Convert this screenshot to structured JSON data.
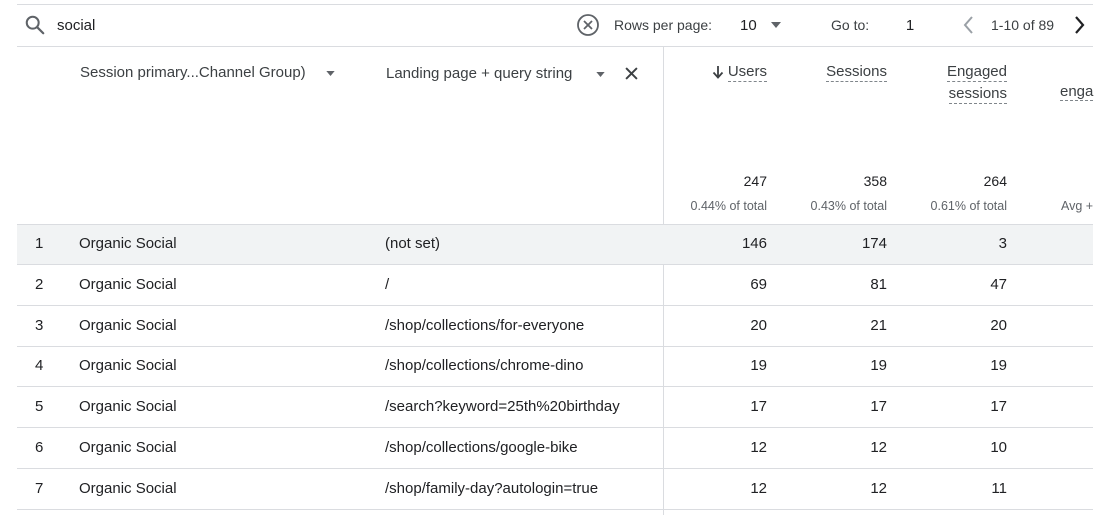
{
  "toolbar": {
    "search_value": "social",
    "rows_per_page_label": "Rows per page:",
    "rows_per_page_value": "10",
    "goto_label": "Go to:",
    "goto_value": "1",
    "range_text": "1-10 of 89"
  },
  "columns": {
    "dimension1": "Session primary...Channel Group)",
    "dimension2": "Landing page + query string",
    "users": "Users",
    "sessions": "Sessions",
    "engaged_line1": "Engaged",
    "engaged_line2": "sessions",
    "partial_col": "enga",
    "partial_avg": "Avg +"
  },
  "totals": {
    "users": "247",
    "users_pct": "0.44% of total",
    "sessions": "358",
    "sessions_pct": "0.43% of total",
    "engaged": "264",
    "engaged_pct": "0.61% of total"
  },
  "rows": [
    {
      "idx": "1",
      "channel": "Organic Social",
      "page": "(not set)",
      "users": "146",
      "sessions": "174",
      "engaged": "3"
    },
    {
      "idx": "2",
      "channel": "Organic Social",
      "page": "/",
      "users": "69",
      "sessions": "81",
      "engaged": "47"
    },
    {
      "idx": "3",
      "channel": "Organic Social",
      "page": "/shop/collections/for-everyone",
      "users": "20",
      "sessions": "21",
      "engaged": "20"
    },
    {
      "idx": "4",
      "channel": "Organic Social",
      "page": "/shop/collections/chrome-dino",
      "users": "19",
      "sessions": "19",
      "engaged": "19"
    },
    {
      "idx": "5",
      "channel": "Organic Social",
      "page": "/search?keyword=25th%20birthday",
      "users": "17",
      "sessions": "17",
      "engaged": "17"
    },
    {
      "idx": "6",
      "channel": "Organic Social",
      "page": "/shop/collections/google-bike",
      "users": "12",
      "sessions": "12",
      "engaged": "10"
    },
    {
      "idx": "7",
      "channel": "Organic Social",
      "page": "/shop/family-day?autologin=true",
      "users": "12",
      "sessions": "12",
      "engaged": "11"
    }
  ],
  "icons": {
    "search": "search-icon",
    "clear": "clear-circle-x-icon",
    "dropdown": "caret-down-icon",
    "prev": "chevron-left-icon",
    "next": "chevron-right-icon",
    "remove": "close-icon",
    "sort": "arrow-down-icon"
  }
}
